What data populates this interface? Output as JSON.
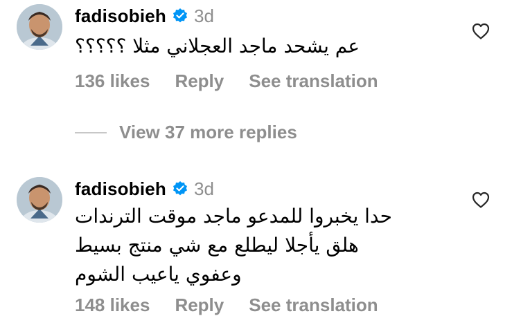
{
  "comments": [
    {
      "username": "fadisobieh",
      "time": "3d",
      "lines": [
        "عم يشحد ماجد العجلاني مثلا ؟؟؟؟؟"
      ],
      "likes": "136 likes",
      "reply": "Reply",
      "translate": "See translation"
    },
    {
      "username": "fadisobieh",
      "time": "3d",
      "lines": [
        "حدا يخبروا للمدعو ماجد  موقت الترندات",
        "هلق  يأجلا ليطلع مع شي منتج  بسيط",
        "وعفوي  ياعيب الشوم"
      ],
      "likes": "148 likes",
      "reply": "Reply",
      "translate": "See translation"
    }
  ],
  "view_more": "View 37 more replies",
  "colors": {
    "verified": "#0095f6",
    "muted": "#8e8e8e"
  },
  "icons": {
    "verified": "verified-badge-icon",
    "like": "heart-outline-icon"
  }
}
